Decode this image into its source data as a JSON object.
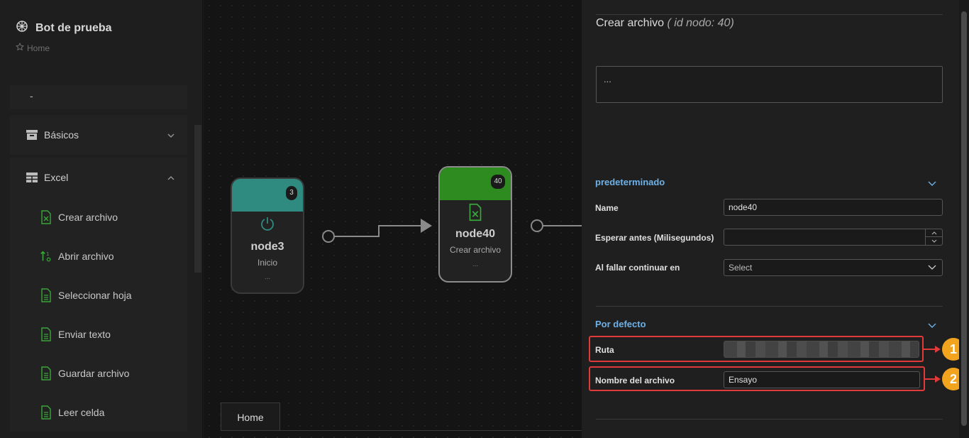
{
  "app": {
    "title": "Bot de prueba",
    "breadcrumb": "Home"
  },
  "sidebar": {
    "dash": "-",
    "groups": [
      {
        "label": "Básicos",
        "icon": "archive-icon",
        "expanded": false
      },
      {
        "label": "Excel",
        "icon": "table-icon",
        "expanded": true
      }
    ],
    "items": [
      {
        "label": "Crear archivo",
        "icon": "excel-file-icon"
      },
      {
        "label": "Abrir archivo",
        "icon": "sort-icon"
      },
      {
        "label": "Seleccionar hoja",
        "icon": "document-icon"
      },
      {
        "label": "Enviar texto",
        "icon": "document-icon"
      },
      {
        "label": "Guardar archivo",
        "icon": "document-icon"
      },
      {
        "label": "Leer celda",
        "icon": "document-icon"
      }
    ]
  },
  "canvas": {
    "nodes": [
      {
        "id": "3",
        "name": "node3",
        "type": "Inicio",
        "dots": "...",
        "color": "#2f8a80",
        "icon": "power-icon"
      },
      {
        "id": "40",
        "name": "node40",
        "type": "Crear archivo",
        "dots": "...",
        "color": "#2e8b1f",
        "icon": "excel-file-icon"
      }
    ],
    "tab": "Home"
  },
  "panel": {
    "title": "Crear archivo",
    "subtitle": "( id nodo: 40)",
    "description": "...",
    "section1": {
      "title": "predeterminado",
      "fields": [
        {
          "label": "Name",
          "value": "node40"
        },
        {
          "label": "Esperar antes (Milisegundos)",
          "value": ""
        },
        {
          "label": "Al fallar continuar en",
          "value": "Select"
        }
      ]
    },
    "section2": {
      "title": "Por defecto",
      "fields": [
        {
          "label": "Ruta",
          "value": ""
        },
        {
          "label": "Nombre del archivo",
          "value": "Ensayo"
        }
      ]
    },
    "callouts": [
      "1",
      "2"
    ]
  },
  "colors": {
    "accent": "#6fb1e6",
    "highlight": "#e03a3a",
    "callout": "#f2a41e",
    "excel_green": "#3aa53a"
  }
}
